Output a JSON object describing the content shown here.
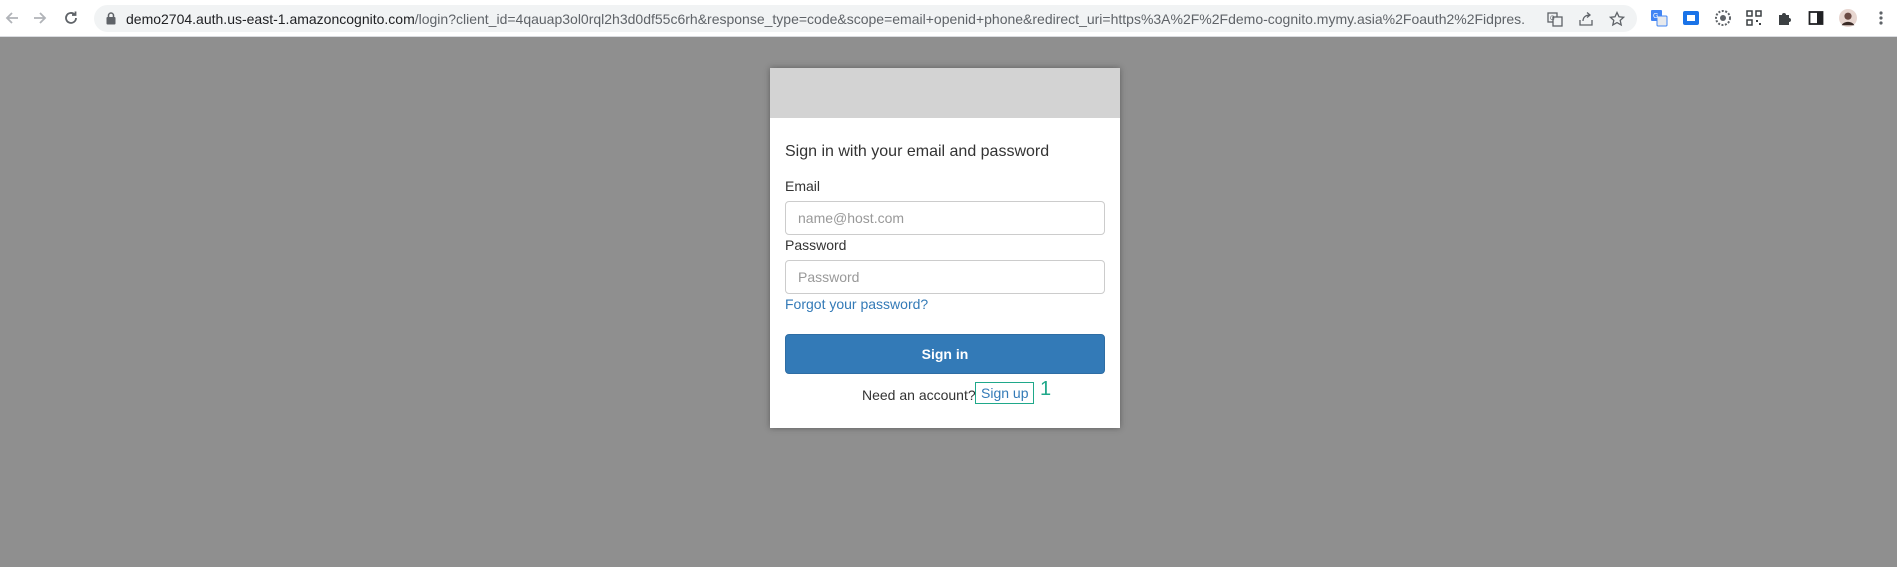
{
  "browser": {
    "url_host": "demo2704.auth.us-east-1.amazoncognito.com",
    "url_rest": "/login?client_id=4qauap3ol0rql2h3d0df55c6rh&response_type=code&scope=email+openid+phone&redirect_uri=https%3A%2F%2Fdemo-cognito.mymy.asia%2Foauth2%2Fidpres...",
    "icons": [
      "back-icon",
      "forward-icon",
      "reload-icon",
      "lock-icon",
      "translate-icon",
      "share-icon",
      "star-icon",
      "extension-icon",
      "profile-avatar"
    ]
  },
  "login": {
    "heading": "Sign in with your email and password",
    "email_label": "Email",
    "email_placeholder": "name@host.com",
    "password_label": "Password",
    "password_placeholder": "Password",
    "forgot_link": "Forgot your password?",
    "signin_button": "Sign in",
    "need_account": "Need an account?",
    "signup_link": "Sign up",
    "annotation_number": "1"
  },
  "colors": {
    "page_background": "#8f8f8f",
    "banner": "#d3d3d3",
    "primary": "#337ab7",
    "annotation": "#1fa88a"
  }
}
